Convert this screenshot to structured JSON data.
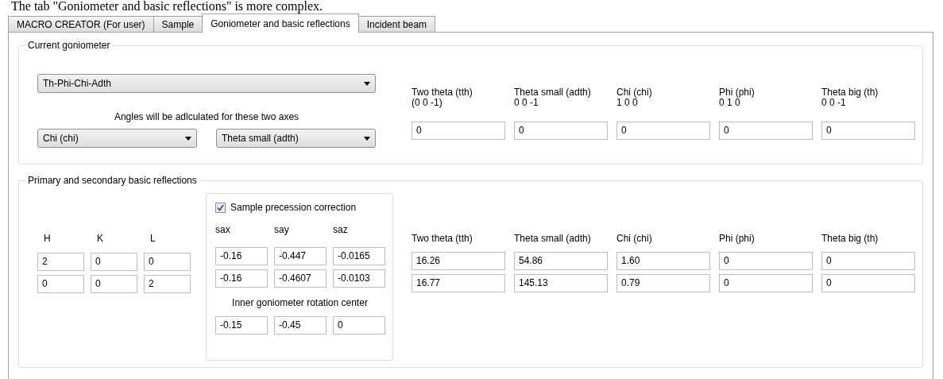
{
  "caption": "The tab \"Goniometer and basic reflections\" is more complex.",
  "tabs": [
    {
      "label": "MACRO CREATOR (For user)",
      "selected": false
    },
    {
      "label": "Sample",
      "selected": false
    },
    {
      "label": "Goniometer and basic reflections",
      "selected": true
    },
    {
      "label": "Incident beam",
      "selected": false
    }
  ],
  "goniometer": {
    "title": "Current goniometer",
    "type_select": "Th-Phi-Chi-Adth",
    "axes_note": "Angles will be adlculated for these two axes",
    "axis_selects": [
      "Chi (chi)",
      "Theta small (adth)"
    ],
    "angles": [
      {
        "name": "Two theta (tth)",
        "direction": "(0 0 -1)",
        "value": "0"
      },
      {
        "name": "Theta small (adth)",
        "direction": "0 0 -1",
        "value": "0"
      },
      {
        "name": "Chi (chi)",
        "direction": "1 0 0",
        "value": "0"
      },
      {
        "name": "Phi (phi)",
        "direction": "0 1 0",
        "value": "0"
      },
      {
        "name": "Theta big (th)",
        "direction": "0 0 -1",
        "value": "0"
      }
    ]
  },
  "reflections": {
    "title": "Primary and secondary basic reflections",
    "hkl_headers": [
      "H",
      "K",
      "L"
    ],
    "hkl_rows": [
      [
        "2",
        "0",
        "0"
      ],
      [
        "0",
        "0",
        "2"
      ]
    ],
    "precession": {
      "label": "Sample precession correction",
      "checked": true,
      "headers": [
        "sax",
        "say",
        "saz"
      ],
      "rows": [
        [
          "-0.16",
          "-0.447",
          "-0.0165"
        ],
        [
          "-0.16",
          "-0.4607",
          "-0.0103"
        ]
      ],
      "center_label": "Inner goniometer rotation center",
      "center": [
        "-0.15",
        "-0.45",
        "0"
      ]
    },
    "angle_headers": [
      "Two theta (tth)",
      "Theta small (adth)",
      "Chi (chi)",
      "Phi (phi)",
      "Theta big (th)"
    ],
    "angle_rows": [
      [
        "16.26",
        "54.86",
        "1.60",
        "0",
        "0"
      ],
      [
        "16.77",
        "145.13",
        "0.79",
        "0",
        "0"
      ]
    ]
  }
}
